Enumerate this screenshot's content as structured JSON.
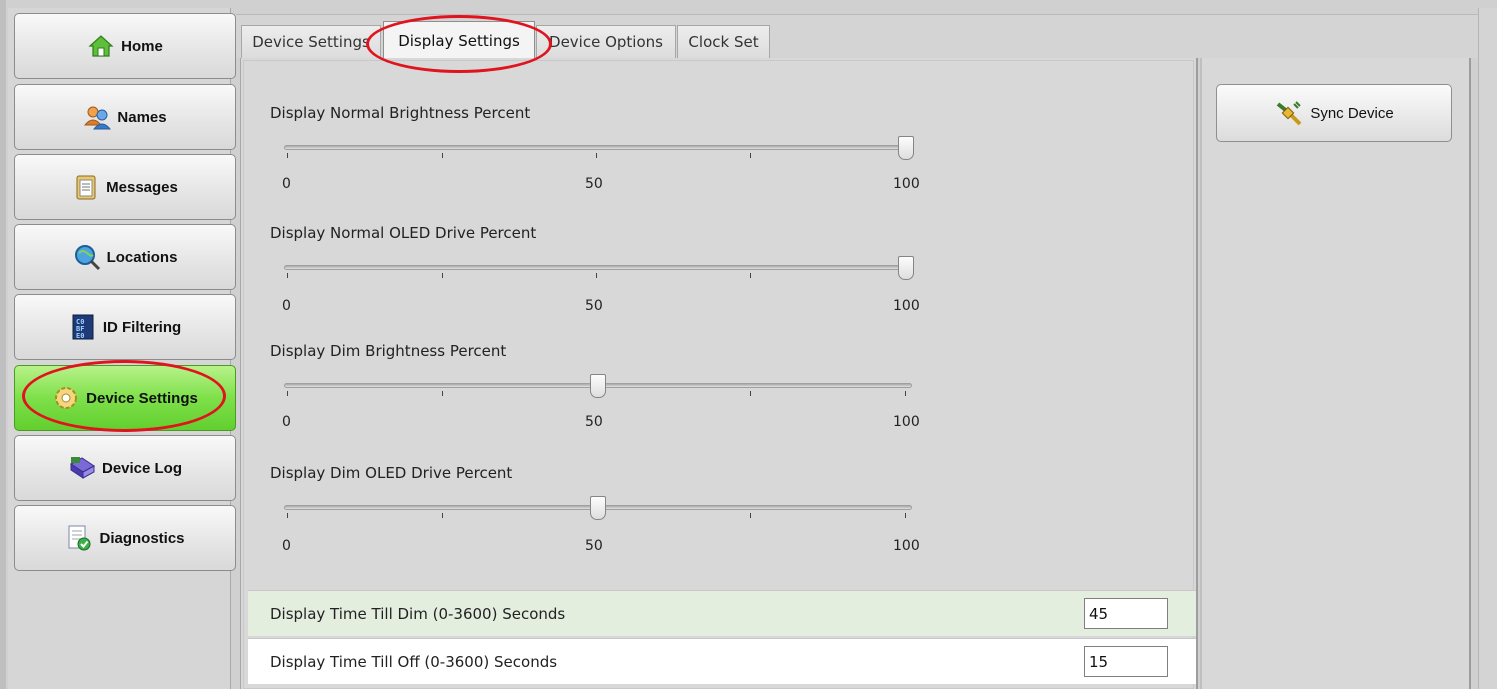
{
  "sidebar": {
    "items": [
      {
        "label": "Home",
        "icon": "home-icon"
      },
      {
        "label": "Names",
        "icon": "users-icon"
      },
      {
        "label": "Messages",
        "icon": "clipboard-icon"
      },
      {
        "label": "Locations",
        "icon": "magnifier-globe-icon"
      },
      {
        "label": "ID Filtering",
        "icon": "binary-filter-icon"
      },
      {
        "label": "Device Settings",
        "icon": "gear-icon",
        "active": true
      },
      {
        "label": "Device Log",
        "icon": "log-book-icon"
      },
      {
        "label": "Diagnostics",
        "icon": "diagnostics-check-icon"
      }
    ]
  },
  "tabs": [
    {
      "label": "Device Settings"
    },
    {
      "label": "Display Settings",
      "active": true
    },
    {
      "label": "Device Options"
    },
    {
      "label": "Clock Set"
    }
  ],
  "sliders": [
    {
      "label": "Display Normal Brightness Percent",
      "value": 100,
      "min_label": "0",
      "mid_label": "50",
      "max_label": "100"
    },
    {
      "label": "Display Normal OLED Drive Percent",
      "value": 100,
      "min_label": "0",
      "mid_label": "50",
      "max_label": "100"
    },
    {
      "label": "Display Dim Brightness Percent",
      "value": 50,
      "min_label": "0",
      "mid_label": "50",
      "max_label": "100"
    },
    {
      "label": "Display Dim OLED Drive Percent",
      "value": 50,
      "min_label": "0",
      "mid_label": "50",
      "max_label": "100"
    }
  ],
  "fields": [
    {
      "label": "Display Time Till Dim (0-3600) Seconds",
      "value": "45"
    },
    {
      "label": "Display Time Till Off (0-3600) Seconds",
      "value": "15"
    }
  ],
  "actions": {
    "sync_label": "Sync Device"
  },
  "colors": {
    "active_nav": "#7ee04a",
    "annotation_oval": "#e0141e",
    "highlight_row": "#e3eedf"
  }
}
